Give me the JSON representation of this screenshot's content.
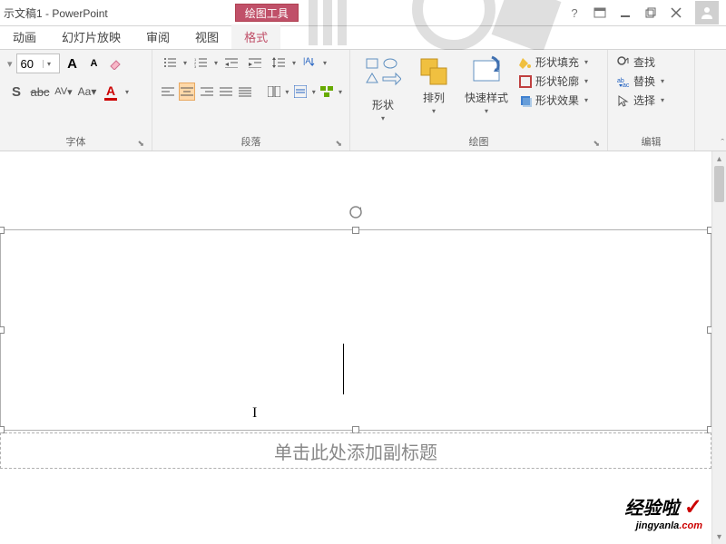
{
  "window": {
    "title": "示文稿1 - PowerPoint",
    "contextual_tab": "绘图工具",
    "help": "?"
  },
  "tabs": {
    "items": [
      "动画",
      "幻灯片放映",
      "审阅",
      "视图",
      "格式"
    ],
    "active": "格式"
  },
  "ribbon": {
    "font": {
      "label": "字体",
      "size": "60",
      "big_a": "A",
      "small_a": "A",
      "s": "S",
      "abc": "abc",
      "av": "AV",
      "aa": "Aa",
      "color_a": "A"
    },
    "paragraph": {
      "label": "段落"
    },
    "drawing": {
      "label": "绘图",
      "shapes": "形状",
      "arrange": "排列",
      "quick_styles": "快速样式",
      "shape_fill": "形状填充",
      "shape_outline": "形状轮廓",
      "shape_effects": "形状效果"
    },
    "editing": {
      "label": "编辑",
      "find": "查找",
      "replace": "替换",
      "select": "选择"
    }
  },
  "slide": {
    "subtitle_placeholder": "单击此处添加副标题",
    "ibeam": "I"
  },
  "watermark": {
    "text": "经验啦",
    "check": "✓",
    "url_main": "jingyanla",
    "url_com": ".com"
  }
}
